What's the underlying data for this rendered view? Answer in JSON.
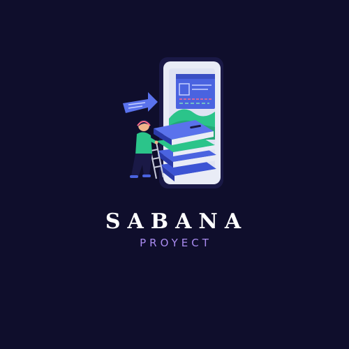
{
  "logo": {
    "name": "SABANA",
    "tagline": "PROYECT"
  },
  "colors": {
    "background": "#0f0e2c",
    "name_text": "#ffffff",
    "tagline_text": "#a98bf0",
    "accent_blue": "#4a63e0",
    "accent_green": "#2bc48a"
  },
  "icons": {
    "illustration": "person-climbing-ladder-to-books-and-phone-icon",
    "speech": "speech-bubble-arrow-icon"
  }
}
